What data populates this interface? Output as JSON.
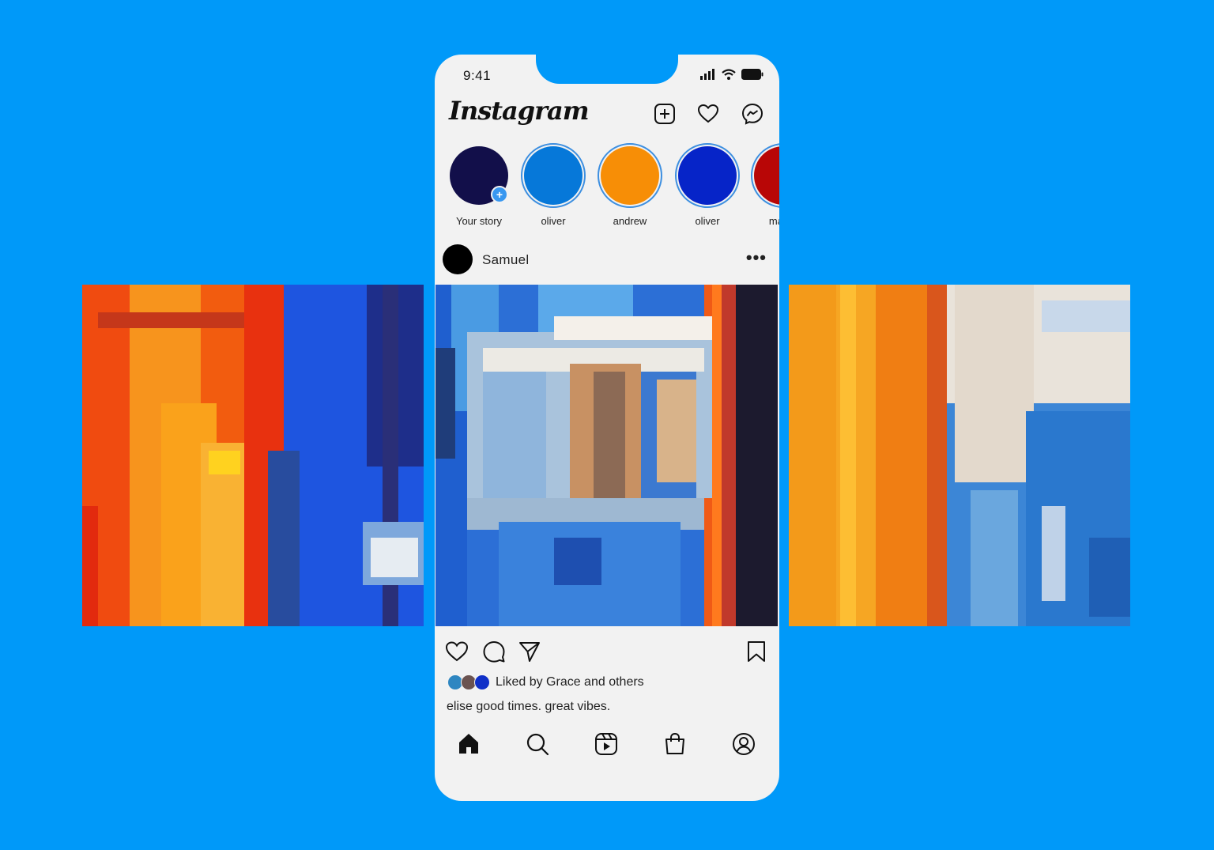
{
  "status_bar": {
    "time": "9:41"
  },
  "header": {
    "logo": "Instagram",
    "icons": [
      "add-post-icon",
      "heart-icon",
      "messenger-icon"
    ]
  },
  "stories": [
    {
      "label": "Your story",
      "color": "#120F4A",
      "own": true
    },
    {
      "label": "oliver",
      "color": "#0678D9"
    },
    {
      "label": "andrew",
      "color": "#F78E06"
    },
    {
      "label": "oliver",
      "color": "#0624C8"
    },
    {
      "label": "mateo",
      "color": "#B80606"
    }
  ],
  "post": {
    "username": "Samuel",
    "more": "•••",
    "liked_by": "Liked by Grace and others",
    "liked_avatars": [
      "#2E86C1",
      "#6B5350",
      "#1030C8"
    ],
    "caption": "elise good times. great vibes."
  },
  "tab_bar": [
    "home-icon",
    "search-icon",
    "reels-icon",
    "shop-icon",
    "profile-icon"
  ],
  "colors": {
    "background": "#0099F9",
    "phone": "#F2F2F2",
    "accent": "#3897F0"
  }
}
